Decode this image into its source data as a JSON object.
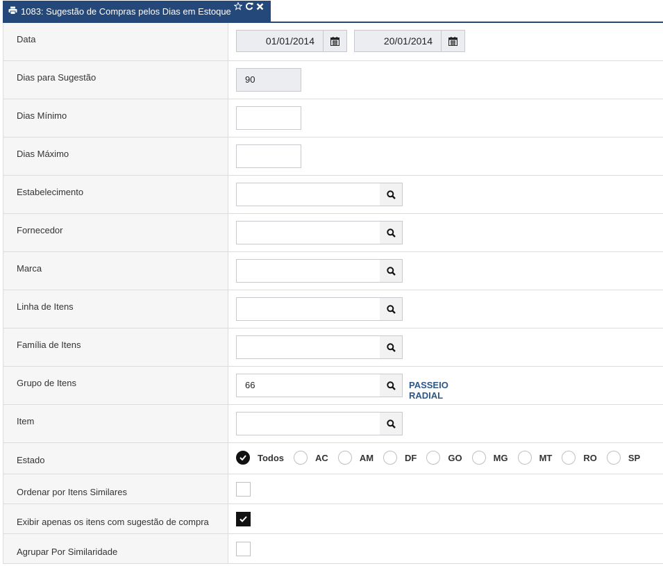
{
  "window": {
    "tab_title": "1083: Sugestão de Compras pelos Dias em Estoque",
    "accent_color": "#25487a",
    "icons": [
      "print-icon",
      "star-icon",
      "refresh-icon",
      "close-icon"
    ]
  },
  "form": {
    "data": {
      "label": "Data",
      "start": "01/01/2014",
      "end": "20/01/2014"
    },
    "dias_sugestao": {
      "label": "Dias para Sugestão",
      "value": "90"
    },
    "dias_minimo": {
      "label": "Dias Mínimo",
      "value": ""
    },
    "dias_maximo": {
      "label": "Dias Máximo",
      "value": ""
    },
    "estabelecimento": {
      "label": "Estabelecimento",
      "value": ""
    },
    "fornecedor": {
      "label": "Fornecedor",
      "value": ""
    },
    "marca": {
      "label": "Marca",
      "value": ""
    },
    "linha_itens": {
      "label": "Linha de Itens",
      "value": ""
    },
    "familia_itens": {
      "label": "Família de Itens",
      "value": ""
    },
    "grupo_itens": {
      "label": "Grupo de Itens",
      "value": "66",
      "description": "PASSEIO RADIAL"
    },
    "item": {
      "label": "Item",
      "value": ""
    },
    "estado": {
      "label": "Estado",
      "selected": "Todos",
      "options": [
        "Todos",
        "AC",
        "AM",
        "DF",
        "GO",
        "MG",
        "MT",
        "RO",
        "SP"
      ]
    },
    "ordenar_similares": {
      "label": "Ordenar por Itens Similares",
      "checked": false
    },
    "exibir_sugestao": {
      "label": "Exibir apenas os itens com sugestão de compra",
      "checked": true
    },
    "agrupar_similaridade": {
      "label": "Agrupar Por Similaridade",
      "checked": false
    }
  }
}
